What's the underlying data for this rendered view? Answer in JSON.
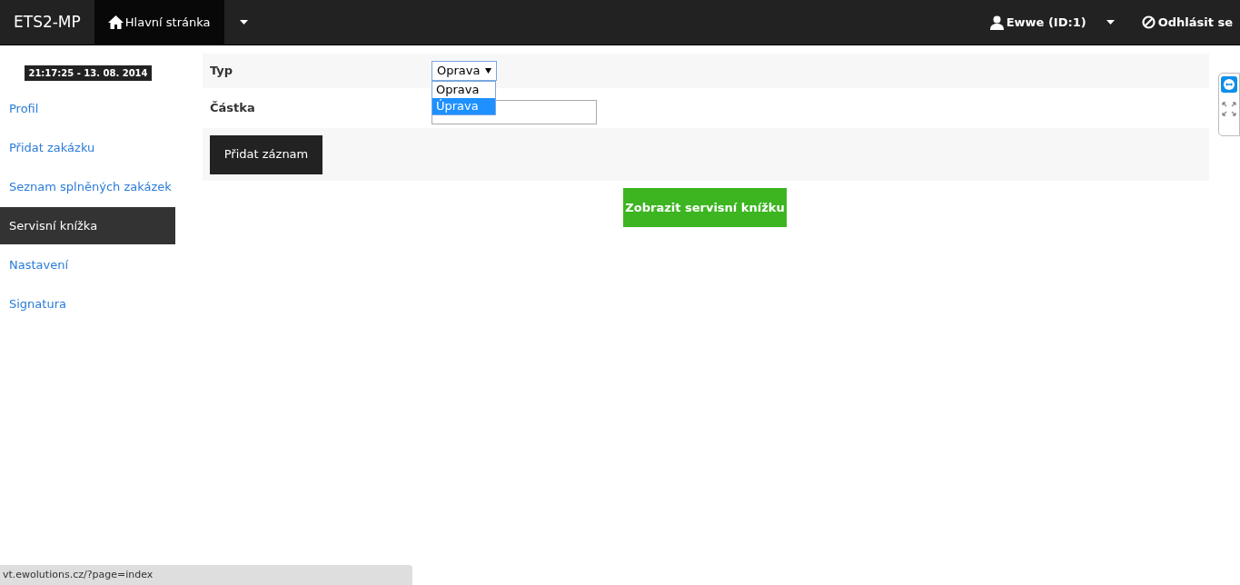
{
  "navbar": {
    "brand": "ETS2-MP",
    "items": [
      {
        "label": "Hlavní stránka",
        "selected": true
      }
    ],
    "user": "Ewwe (ID:1)",
    "logout": "Odhlásit se"
  },
  "sidebar": {
    "clock": "21:17:25 - 13. 08. 2014",
    "items": [
      {
        "label": "Profil",
        "selected": false
      },
      {
        "label": "Přidat zakázku",
        "selected": false
      },
      {
        "label": "Seznam splněných zakázek",
        "selected": false
      },
      {
        "label": "Servisní knížka",
        "selected": true
      },
      {
        "label": "Nastavení",
        "selected": false
      },
      {
        "label": "Signatura",
        "selected": false
      }
    ]
  },
  "form": {
    "type_field": {
      "label": "Typ",
      "value": "Oprava",
      "expanded": true,
      "options": [
        {
          "label": "Oprava",
          "highlighted": false
        },
        {
          "label": "Úprava",
          "highlighted": true
        }
      ]
    },
    "amount_field": {
      "label": "Částka"
    },
    "submit_button": "Přidat záznam"
  },
  "show_button": "Zobrazit servisní knížku",
  "status_bar": "vt.ewolutions.cz/?page=index"
}
